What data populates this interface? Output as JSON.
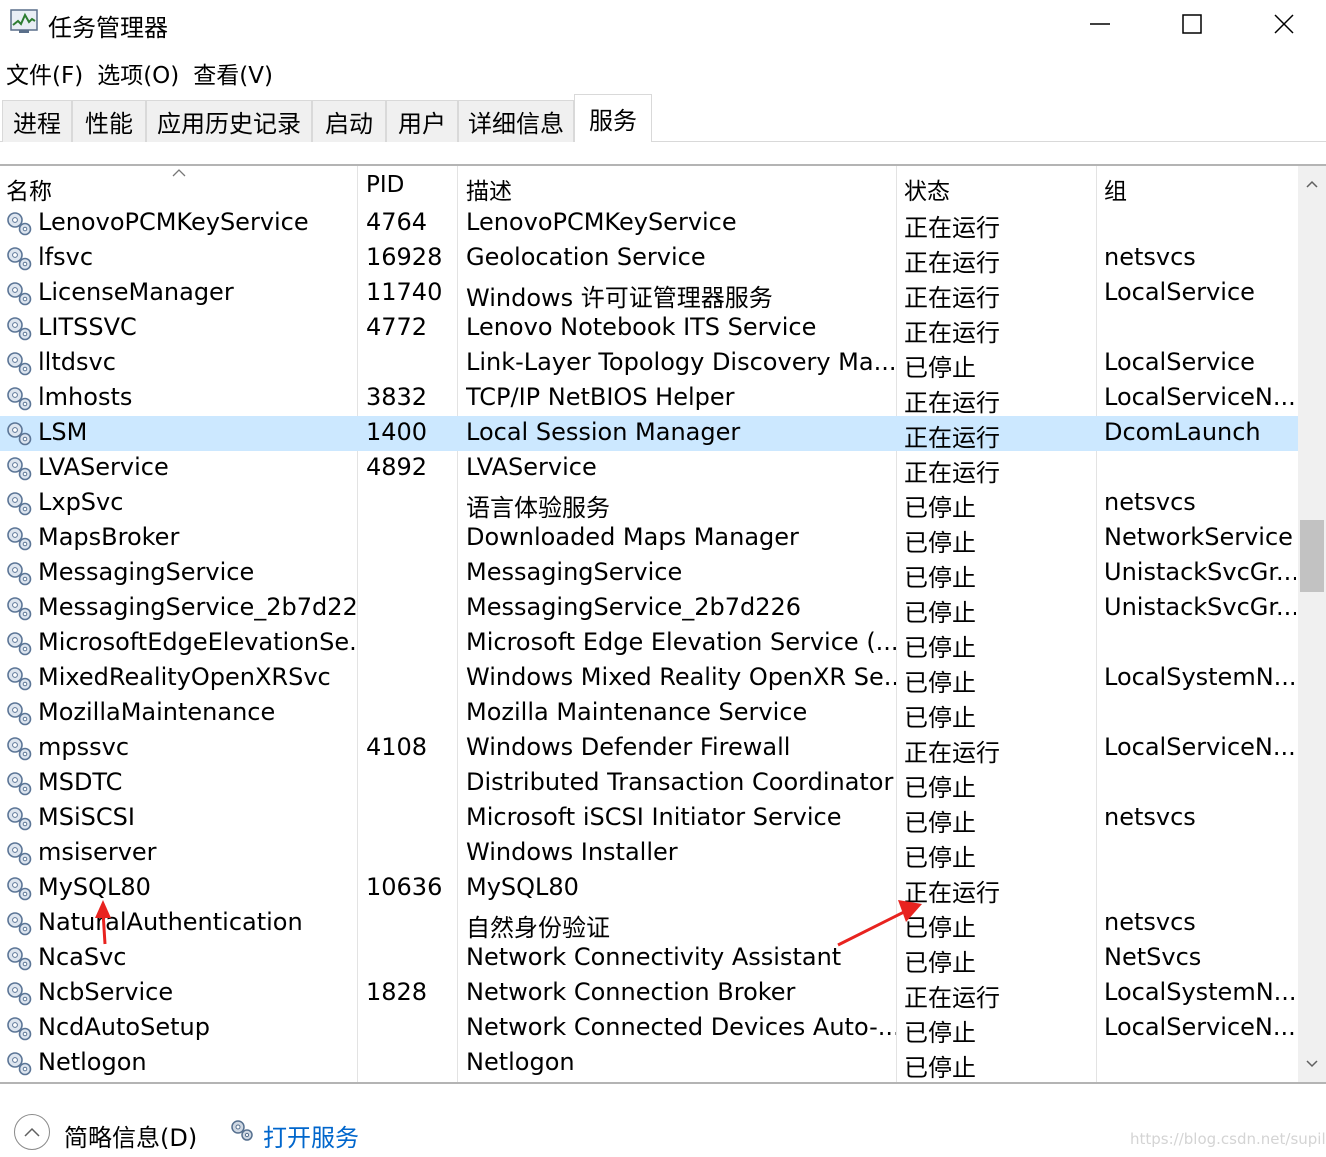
{
  "window": {
    "title": "任务管理器",
    "minimize_icon": "minimize-icon",
    "maximize_icon": "maximize-icon",
    "close_icon": "close-icon"
  },
  "menu": [
    {
      "label": "文件(F)"
    },
    {
      "label": "选项(O)"
    },
    {
      "label": "查看(V)"
    }
  ],
  "tabs": [
    {
      "label": "进程"
    },
    {
      "label": "性能"
    },
    {
      "label": "应用历史记录"
    },
    {
      "label": "启动"
    },
    {
      "label": "用户"
    },
    {
      "label": "详细信息"
    },
    {
      "label": "服务",
      "active": true
    }
  ],
  "columns": {
    "name": "名称",
    "pid": "PID",
    "desc": "描述",
    "status": "状态",
    "group": "组"
  },
  "rows": [
    {
      "name": "LenovoPCMKeyService",
      "pid": "4764",
      "desc": "LenovoPCMKeyService",
      "status": "正在运行",
      "group": ""
    },
    {
      "name": "lfsvc",
      "pid": "16928",
      "desc": "Geolocation Service",
      "status": "正在运行",
      "group": "netsvcs"
    },
    {
      "name": "LicenseManager",
      "pid": "11740",
      "desc": "Windows 许可证管理器服务",
      "status": "正在运行",
      "group": "LocalService"
    },
    {
      "name": "LITSSVC",
      "pid": "4772",
      "desc": "Lenovo Notebook ITS Service",
      "status": "正在运行",
      "group": ""
    },
    {
      "name": "lltdsvc",
      "pid": "",
      "desc": "Link-Layer Topology Discovery Ma...",
      "status": "已停止",
      "group": "LocalService"
    },
    {
      "name": "lmhosts",
      "pid": "3832",
      "desc": "TCP/IP NetBIOS Helper",
      "status": "正在运行",
      "group": "LocalServiceN..."
    },
    {
      "name": "LSM",
      "pid": "1400",
      "desc": "Local Session Manager",
      "status": "正在运行",
      "group": "DcomLaunch",
      "selected": true
    },
    {
      "name": "LVAService",
      "pid": "4892",
      "desc": "LVAService",
      "status": "正在运行",
      "group": ""
    },
    {
      "name": "LxpSvc",
      "pid": "",
      "desc": "语言体验服务",
      "status": "已停止",
      "group": "netsvcs"
    },
    {
      "name": "MapsBroker",
      "pid": "",
      "desc": "Downloaded Maps Manager",
      "status": "已停止",
      "group": "NetworkService"
    },
    {
      "name": "MessagingService",
      "pid": "",
      "desc": "MessagingService",
      "status": "已停止",
      "group": "UnistackSvcGr..."
    },
    {
      "name": "MessagingService_2b7d226",
      "pid": "",
      "desc": "MessagingService_2b7d226",
      "status": "已停止",
      "group": "UnistackSvcGr..."
    },
    {
      "name": "MicrosoftEdgeElevationSe...",
      "pid": "",
      "desc": "Microsoft Edge Elevation Service (...",
      "status": "已停止",
      "group": ""
    },
    {
      "name": "MixedRealityOpenXRSvc",
      "pid": "",
      "desc": "Windows Mixed Reality OpenXR Se...",
      "status": "已停止",
      "group": "LocalSystemN..."
    },
    {
      "name": "MozillaMaintenance",
      "pid": "",
      "desc": "Mozilla Maintenance Service",
      "status": "已停止",
      "group": ""
    },
    {
      "name": "mpssvc",
      "pid": "4108",
      "desc": "Windows Defender Firewall",
      "status": "正在运行",
      "group": "LocalServiceN..."
    },
    {
      "name": "MSDTC",
      "pid": "",
      "desc": "Distributed Transaction Coordinator",
      "status": "已停止",
      "group": ""
    },
    {
      "name": "MSiSCSI",
      "pid": "",
      "desc": "Microsoft iSCSI Initiator Service",
      "status": "已停止",
      "group": "netsvcs"
    },
    {
      "name": "msiserver",
      "pid": "",
      "desc": "Windows Installer",
      "status": "已停止",
      "group": ""
    },
    {
      "name": "MySQL80",
      "pid": "10636",
      "desc": "MySQL80",
      "status": "正在运行",
      "group": ""
    },
    {
      "name": "NaturalAuthentication",
      "pid": "",
      "desc": "自然身份验证",
      "status": "已停止",
      "group": "netsvcs"
    },
    {
      "name": "NcaSvc",
      "pid": "",
      "desc": "Network Connectivity Assistant",
      "status": "已停止",
      "group": "NetSvcs"
    },
    {
      "name": "NcbService",
      "pid": "1828",
      "desc": "Network Connection Broker",
      "status": "正在运行",
      "group": "LocalSystemN..."
    },
    {
      "name": "NcdAutoSetup",
      "pid": "",
      "desc": "Network Connected Devices Auto-...",
      "status": "已停止",
      "group": "LocalServiceN..."
    },
    {
      "name": "Netlogon",
      "pid": "",
      "desc": "Netlogon",
      "status": "已停止",
      "group": ""
    }
  ],
  "footer": {
    "fewer_details": "简略信息(D)",
    "open_services": "打开服务",
    "watermark": "https://blog.csdn.net/supiltl"
  },
  "colors": {
    "selected_row": "#cce8ff",
    "link": "#0066cc",
    "annotation_arrow": "#e8231f"
  }
}
